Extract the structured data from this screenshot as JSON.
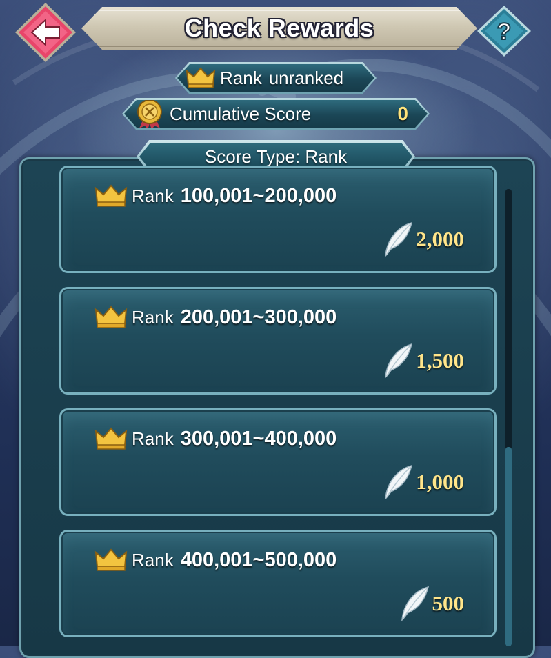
{
  "header": {
    "title": "Check Rewards",
    "back_icon": "back-arrow-icon",
    "help_label": "?"
  },
  "status": {
    "rank_label": "Rank",
    "rank_value": "unranked",
    "score_label": "Cumulative Score",
    "score_value": "0"
  },
  "panel": {
    "score_type": "Score Type: Rank"
  },
  "rewards": [
    {
      "label": "Rank",
      "range": "100,001~200,000",
      "amount": "2,000"
    },
    {
      "label": "Rank",
      "range": "200,001~300,000",
      "amount": "1,500"
    },
    {
      "label": "Rank",
      "range": "300,001~400,000",
      "amount": "1,000"
    },
    {
      "label": "Rank",
      "range": "400,001~500,000",
      "amount": "500"
    }
  ],
  "colors": {
    "gold": "#ffe58a",
    "panel": "#1d4454",
    "back_button": "#e8456a"
  }
}
